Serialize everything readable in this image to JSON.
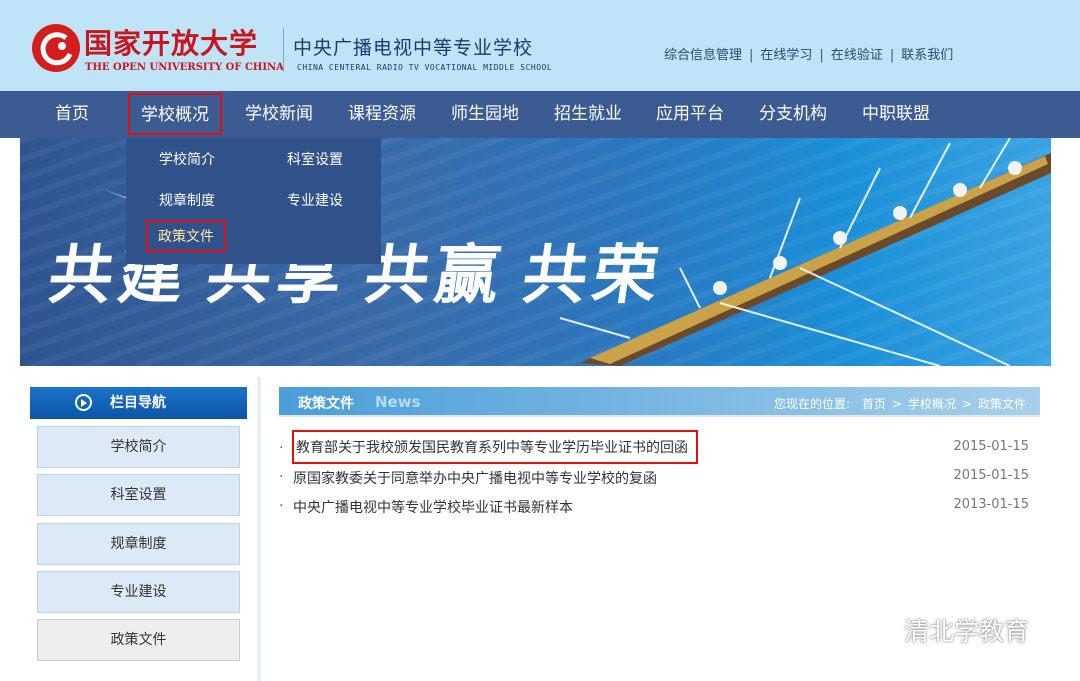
{
  "header": {
    "logo_cn": "国家开放大学",
    "logo_en": "THE OPEN UNIVERSITY OF CHINA",
    "school_cn": "中央广播电视中等专业学校",
    "school_en": "CHINA CENTERAL RADIO TV VOCATIONAL MIDDLE SCHOOL",
    "links": [
      "综合信息管理",
      "在线学习",
      "在线验证",
      "联系我们"
    ],
    "separator": "|"
  },
  "nav": {
    "items": [
      "首页",
      "学校概况",
      "学校新闻",
      "课程资源",
      "师生园地",
      "招生就业",
      "应用平台",
      "分支机构",
      "中职联盟"
    ],
    "active_index": 1
  },
  "dropdown": {
    "items": [
      "学校简介",
      "科室设置",
      "规章制度",
      "专业建设",
      "政策文件"
    ],
    "active_index": 4
  },
  "banner": {
    "slogan": [
      "共建",
      "共享",
      "共赢",
      "共荣"
    ]
  },
  "sidebar": {
    "title": "栏目导航",
    "icon": "play-circle-icon",
    "items": [
      "学校简介",
      "科室设置",
      "规章制度",
      "专业建设",
      "政策文件"
    ]
  },
  "main": {
    "heading": "政策文件",
    "heading_en": "News",
    "breadcrumb": {
      "label": "您现在的位置:",
      "items": [
        "首页",
        "学校概况",
        "政策文件"
      ],
      "separator": ">"
    },
    "news": [
      {
        "title": "教育部关于我校颁发国民教育系列中等专业学历毕业证书的回函",
        "date": "2015-01-15"
      },
      {
        "title": "原国家教委关于同意举办中央广播电视中等专业学校的复函",
        "date": "2015-01-15"
      },
      {
        "title": "中央广播电视中等专业学校毕业证书最新样本",
        "date": "2013-01-15"
      }
    ],
    "bullet": "·"
  },
  "watermark": {
    "text": "清北学教育",
    "icon": "wechat-icon"
  },
  "colors": {
    "header_bg": "#bfe3f7",
    "nav_bg": "#3c5b92",
    "logo_red": "#c9151e",
    "highlight_red": "#e01010",
    "sidebar_head": "#0b55a8"
  }
}
